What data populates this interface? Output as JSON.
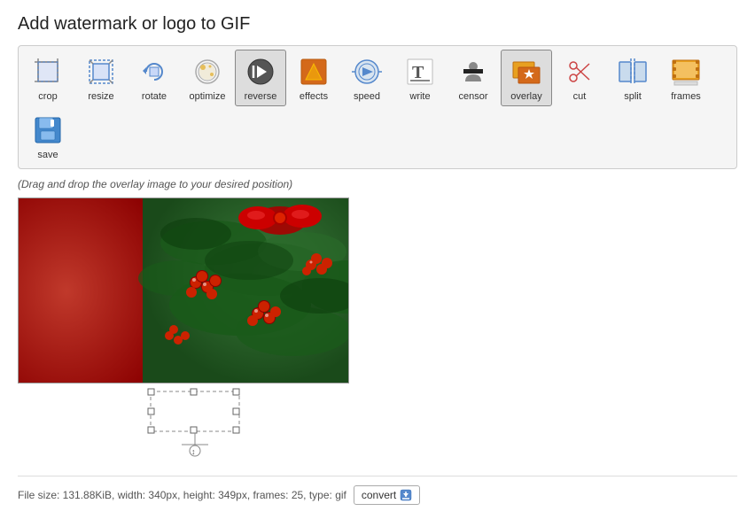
{
  "page": {
    "title": "Add watermark or logo to GIF"
  },
  "hint": "(Drag and drop the overlay image to your desired position)",
  "toolbar": {
    "tools": [
      {
        "id": "crop",
        "label": "crop",
        "active": false
      },
      {
        "id": "resize",
        "label": "resize",
        "active": false
      },
      {
        "id": "rotate",
        "label": "rotate",
        "active": false
      },
      {
        "id": "optimize",
        "label": "optimize",
        "active": false
      },
      {
        "id": "reverse",
        "label": "reverse",
        "active": false
      },
      {
        "id": "effects",
        "label": "effects",
        "active": false
      },
      {
        "id": "speed",
        "label": "speed",
        "active": false
      },
      {
        "id": "write",
        "label": "write",
        "active": false
      },
      {
        "id": "censor",
        "label": "censor",
        "active": false
      },
      {
        "id": "overlay",
        "label": "overlay",
        "active": true
      },
      {
        "id": "cut",
        "label": "cut",
        "active": false
      },
      {
        "id": "split",
        "label": "split",
        "active": false
      },
      {
        "id": "frames",
        "label": "frames",
        "active": false
      },
      {
        "id": "save",
        "label": "save",
        "active": false
      }
    ]
  },
  "footer": {
    "file_info": "File size: 131.88KiB, width: 340px, height: 349px, frames: 25, type: gif",
    "convert_label": "convert"
  }
}
